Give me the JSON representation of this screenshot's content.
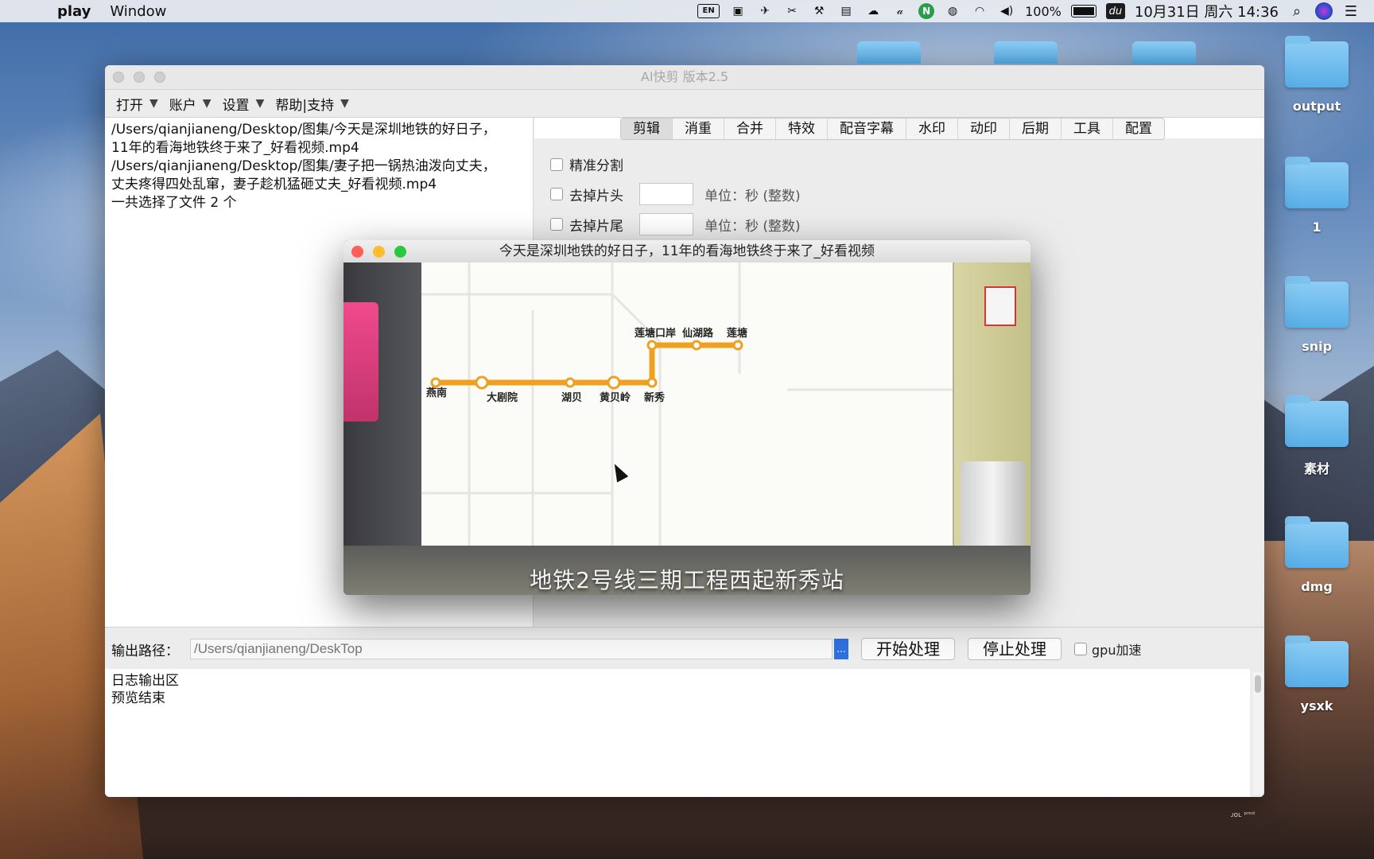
{
  "menubar": {
    "app_name": "play",
    "window_menu": "Window",
    "input_source": "EN",
    "battery": "100%",
    "datetime": "10月31日 周六  14:36",
    "tray_icons": [
      "screen-record-icon",
      "send-icon",
      "scissors-icon",
      "tool-icon",
      "docker-icon",
      "cloud-icon",
      "alfred-icon",
      "green-n-icon",
      "wechat-icon",
      "wifi-icon",
      "volume-icon",
      "battery-icon",
      "du-icon",
      "search-icon",
      "siri-icon",
      "list-icon"
    ]
  },
  "desktop": {
    "folders": [
      {
        "label": "output"
      },
      {
        "label": "1"
      },
      {
        "label": "snip"
      },
      {
        "label": "素材"
      },
      {
        "label": "dmg"
      },
      {
        "label": "ysxk"
      }
    ],
    "footnote": "ᴊᴏʟ ᵖʳᵒᵈ"
  },
  "main_window": {
    "title": "AI快剪  版本2.5",
    "menus": [
      {
        "label": "打开"
      },
      {
        "label": "账户"
      },
      {
        "label": "设置"
      },
      {
        "label": "帮助|支持"
      }
    ],
    "file_list": [
      "/Users/qianjianeng/Desktop/图集/今天是深圳地铁的好日子，",
      "11年的看海地铁终于来了_好看视频.mp4",
      "/Users/qianjianeng/Desktop/图集/妻子把一锅热油泼向丈夫，",
      "丈夫疼得四处乱窜，妻子趁机猛砸丈夫_好看视频.mp4",
      "一共选择了文件 2 个"
    ],
    "tabs": [
      "剪辑",
      "消重",
      "合并",
      "特效",
      "配音字幕",
      "水印",
      "动印",
      "后期",
      "工具",
      "配置"
    ],
    "active_tab": "剪辑",
    "options": {
      "precise_split": "精准分割",
      "trim_head": "去掉片头",
      "trim_tail": "去掉片尾",
      "unit_text": "单位：秒 (整数)"
    },
    "output": {
      "label": "输出路径：",
      "placeholder": "/Users/qianjianeng/DeskTop",
      "browse": "...",
      "start_button": "开始处理",
      "stop_button": "停止处理",
      "gpu_label": "gpu加速"
    },
    "log": {
      "lines": [
        "日志输出区",
        "预览结束"
      ]
    }
  },
  "preview_window": {
    "title": "今天是深圳地铁的好日子，11年的看海地铁终于来了_好看视频",
    "subtitle": "地铁2号线三期工程西起新秀站",
    "stations": {
      "yannan": "燕南",
      "dajuyuan": "大剧院",
      "hubei": "湖贝",
      "huangbeiling": "黄贝岭",
      "xinxiu": "新秀",
      "liantangkouan": "莲塘口岸",
      "xianhulu": "仙湖路",
      "liantang": "莲塘"
    },
    "line_color": "#f0a020"
  }
}
